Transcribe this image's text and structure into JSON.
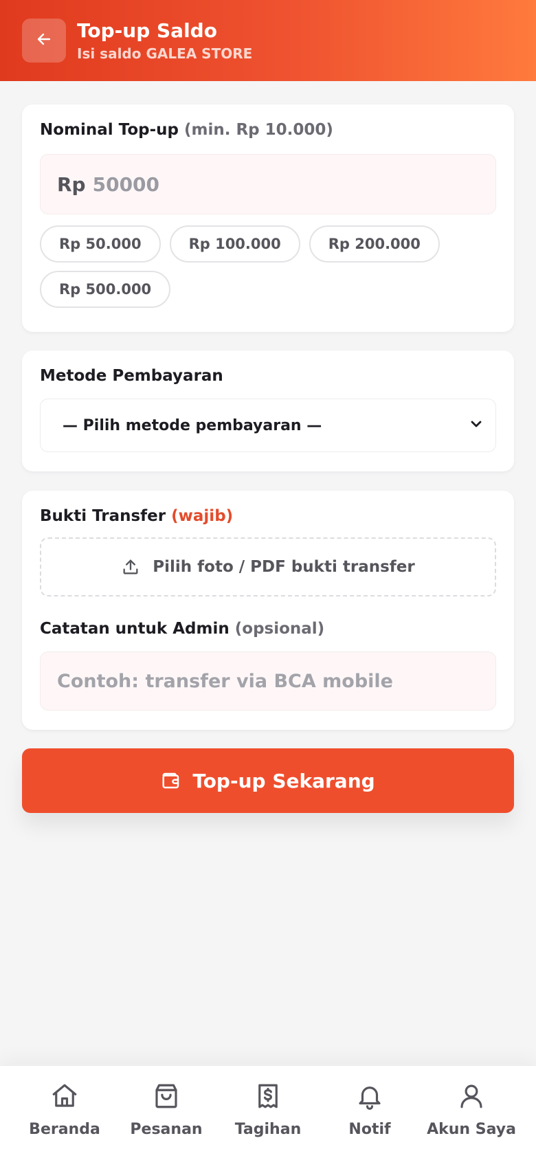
{
  "header": {
    "title": "Top-up Saldo",
    "subtitle": "Isi saldo GALEA STORE",
    "back_icon": "arrow-left-icon"
  },
  "amount": {
    "label": "Nominal Top-up",
    "hint": "(min. Rp 10.000)",
    "prefix": "Rp",
    "placeholder": "50000",
    "presets": [
      "Rp 50.000",
      "Rp 100.000",
      "Rp 200.000",
      "Rp 500.000"
    ]
  },
  "payment": {
    "label": "Metode Pembayaran",
    "selected": "— Pilih metode pembayaran —",
    "icon": "chevron-down-icon"
  },
  "proof": {
    "label": "Bukti Transfer",
    "required": "(wajib)",
    "upload_label": "Pilih foto / PDF bukti transfer",
    "icon": "upload-icon"
  },
  "note": {
    "label": "Catatan untuk Admin",
    "hint": "(opsional)",
    "placeholder": "Contoh: transfer via BCA mobile"
  },
  "submit": {
    "label": "Top-up Sekarang",
    "icon": "wallet-icon"
  },
  "nav": [
    {
      "label": "Beranda",
      "icon": "home-icon"
    },
    {
      "label": "Pesanan",
      "icon": "shopping-bag-icon"
    },
    {
      "label": "Tagihan",
      "icon": "receipt-icon"
    },
    {
      "label": "Notif",
      "icon": "bell-icon"
    },
    {
      "label": "Akun Saya",
      "icon": "user-icon"
    }
  ],
  "colors": {
    "accent": "#ef4e2d",
    "header_start": "#e03a1e",
    "header_end": "#ff7a3d",
    "required": "#e34c2c"
  }
}
